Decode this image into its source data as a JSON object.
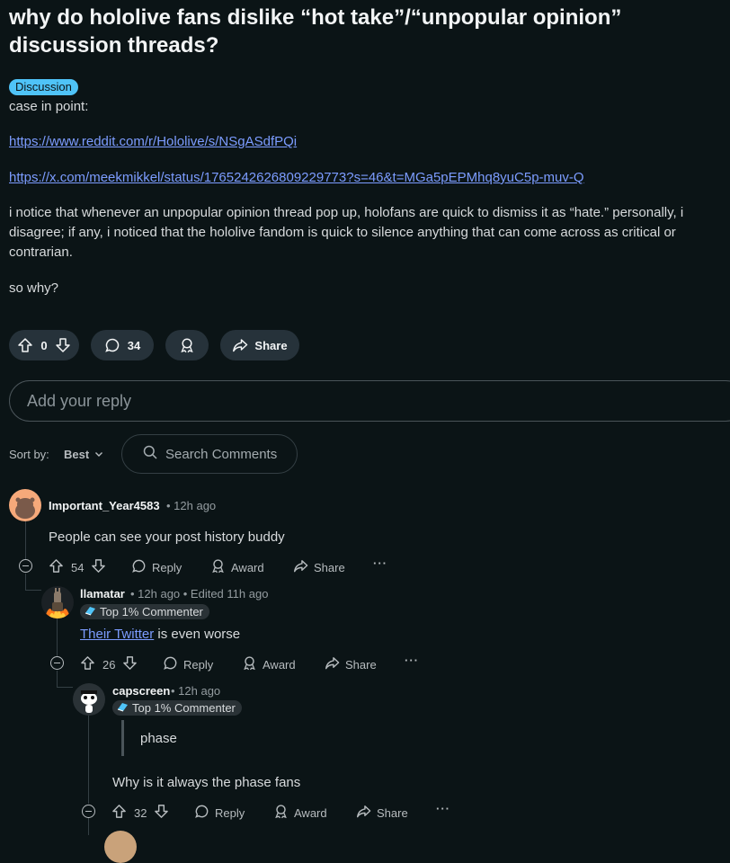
{
  "post": {
    "title": "why do hololive fans dislike “hot take”/“unpopular opinion” discussion threads?",
    "flair": "Discussion",
    "intro": "case in point:",
    "link1": "https://www.reddit.com/r/Hololive/s/NSgASdfPQi",
    "link2": "https://x.com/meekmikkel/status/1765242626809229773?s=46&t=MGa5pEPMhq8yuC5p-muv-Q",
    "paragraph": "i notice that whenever an unpopular opinion thread pop up, holofans are quick to dismiss it as “hate.” personally, i disagree; if any, i noticed that the hololive fandom is quick to silence anything that can come across as critical or contrarian.",
    "closing": "so why?",
    "votes": "0",
    "comments": "34",
    "share_label": "Share"
  },
  "reply_box": {
    "placeholder": "Add your reply"
  },
  "sort": {
    "label": "Sort by:",
    "value": "Best"
  },
  "search": {
    "placeholder": "Search Comments"
  },
  "actions": {
    "reply": "Reply",
    "award": "Award",
    "share": "Share"
  },
  "comments": [
    {
      "user": "Important_Year4583",
      "meta": "• 12h ago",
      "text": "People can see your post history buddy",
      "votes": "54"
    },
    {
      "user": "llamatar",
      "meta": "• 12h ago • Edited 11h ago",
      "badge": "Top 1% Commenter",
      "link_text": "Their Twitter",
      "text_rest": " is even worse",
      "votes": "26"
    },
    {
      "user": "capscreen",
      "meta": "• 12h ago",
      "badge": "Top 1% Commenter",
      "quote": "phase",
      "text": "Why is it always the phase fans",
      "votes": "32"
    }
  ],
  "colors": {
    "background": "#0b1416",
    "flair": "#4fc3f7",
    "link": "#7c9cff",
    "pill": "#26323a"
  }
}
